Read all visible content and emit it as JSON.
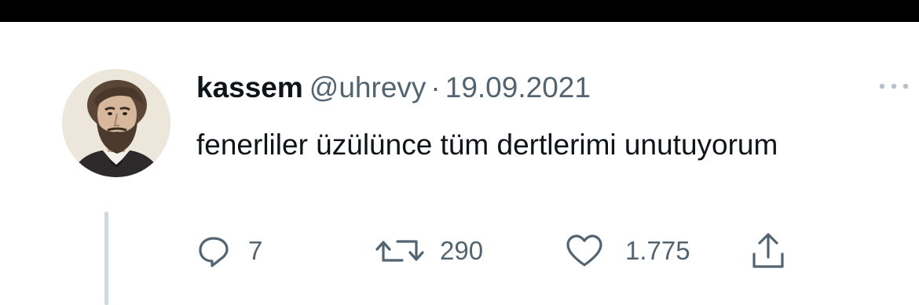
{
  "tweet": {
    "author_name": "kassem",
    "handle": "@uhrevy",
    "separator": "·",
    "date": "19.09.2021",
    "text": "fenerliler üzülünce tüm dertlerimi unutuyorum"
  },
  "actions": {
    "replies": "7",
    "retweets": "290",
    "likes": "1.775"
  },
  "icons": {
    "reply": "reply-icon",
    "retweet": "retweet-icon",
    "like": "heart-icon",
    "share": "share-icon",
    "more": "more-icon"
  },
  "colors": {
    "text": "#0f1419",
    "secondary": "#536471",
    "thread_line": "#cfd9de",
    "top_bar": "#000000"
  }
}
